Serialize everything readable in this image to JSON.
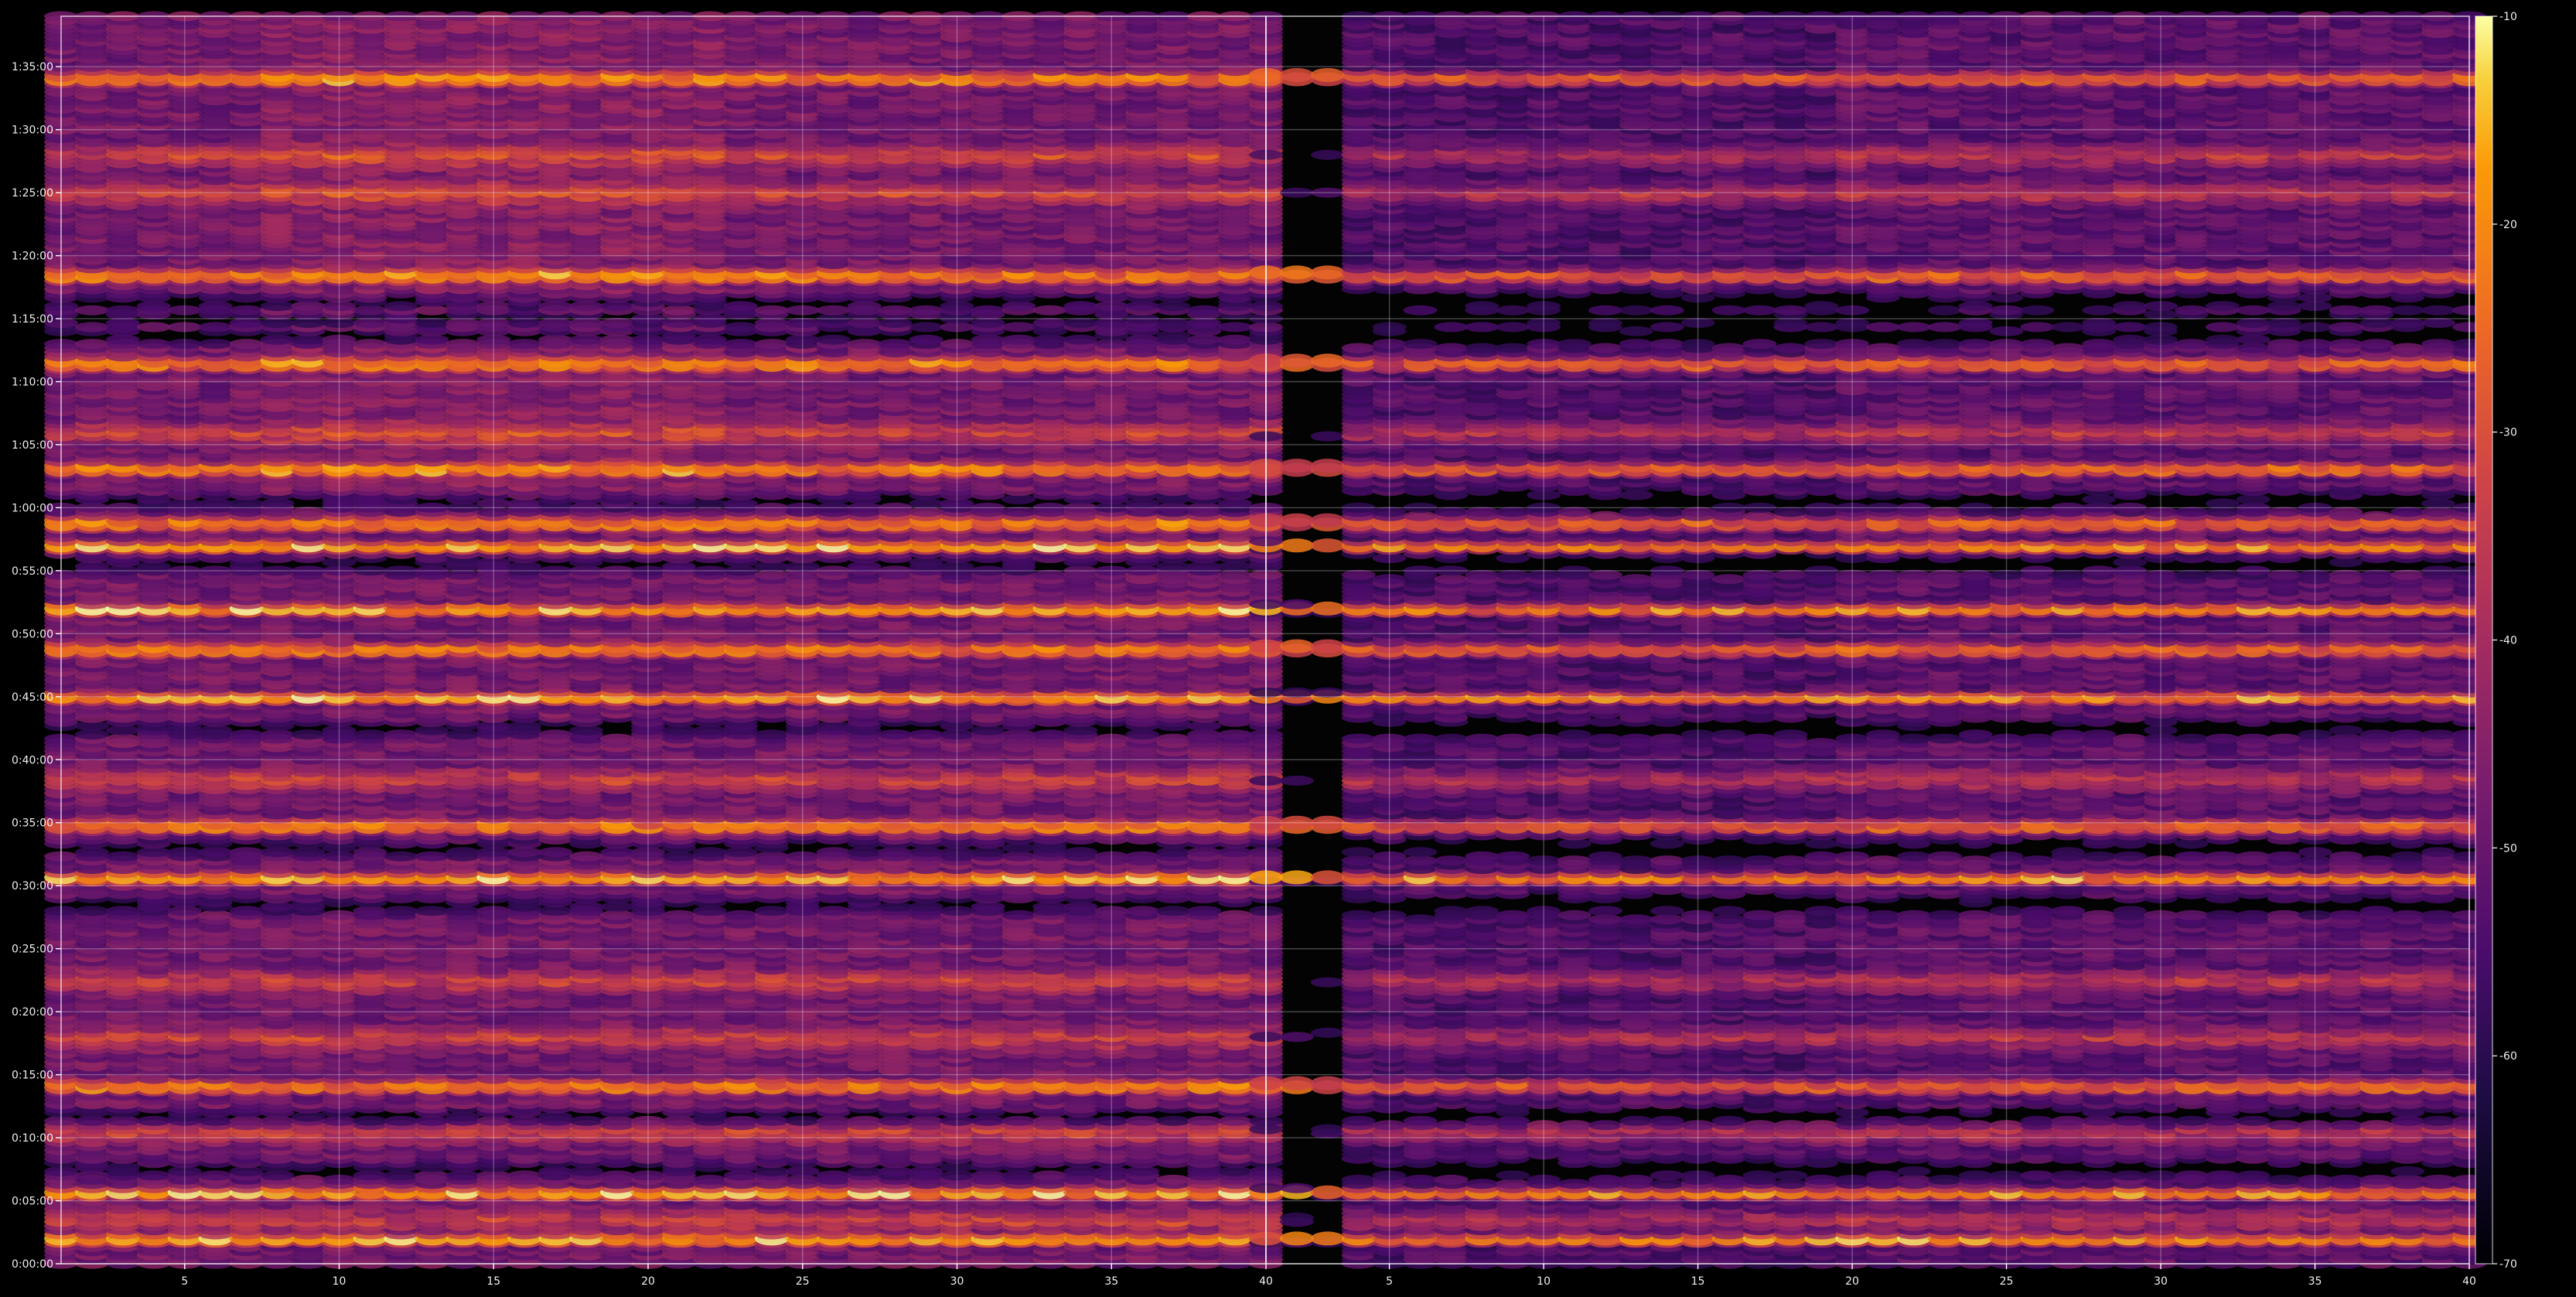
{
  "chart_data": {
    "type": "heatmap",
    "title": "",
    "xlabel": "",
    "ylabel": "",
    "facets": 2,
    "xlim": [
      1,
      40
    ],
    "xticks": [
      5,
      10,
      15,
      20,
      25,
      30,
      35,
      40
    ],
    "ylim_seconds": [
      0,
      5940
    ],
    "yticks": [
      "0:00:00",
      "0:05:00",
      "0:10:00",
      "0:15:00",
      "0:20:00",
      "0:25:00",
      "0:30:00",
      "0:35:00",
      "0:40:00",
      "0:45:00",
      "0:50:00",
      "0:55:00",
      "1:00:00",
      "1:05:00",
      "1:10:00",
      "1:15:00",
      "1:20:00",
      "1:25:00",
      "1:30:00",
      "1:35:00"
    ],
    "colorbar": {
      "min": -70,
      "max": -10,
      "ticks": [
        -10,
        -20,
        -30,
        -40,
        -50,
        -60,
        -70
      ],
      "colormap": "inferno"
    },
    "grid": true,
    "bright_band_times": [
      "0:02:00",
      "0:05:40",
      "0:14:10",
      "0:30:40",
      "0:34:50",
      "0:45:00",
      "0:48:50",
      "0:52:00",
      "0:57:00",
      "0:58:50",
      "1:03:10",
      "1:11:30",
      "1:18:30",
      "1:34:10"
    ],
    "strong_band_times": [
      "0:03:30",
      "0:10:30",
      "0:18:00",
      "0:22:30",
      "0:38:30",
      "1:06:00",
      "1:25:00",
      "1:28:00"
    ],
    "dark_gap_times": [
      "0:07:30",
      "0:11:40",
      "0:28:30",
      "0:33:00",
      "0:42:30",
      "0:55:30",
      "1:00:30",
      "1:13:40",
      "1:15:00",
      "1:16:20"
    ]
  },
  "colors": {
    "background": "#000000",
    "axis": "#ffffff",
    "grid": "#ffffff",
    "text": "#f0f0f0"
  }
}
